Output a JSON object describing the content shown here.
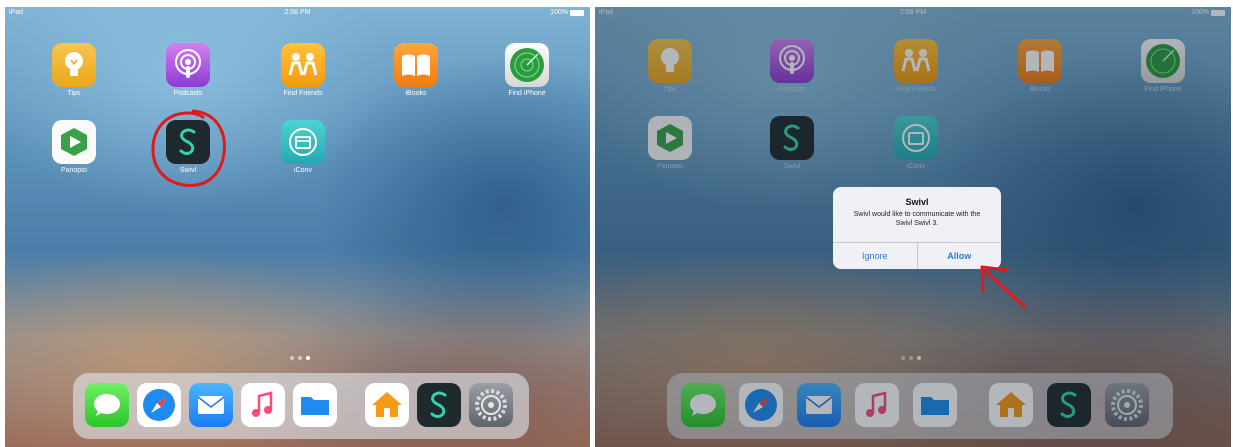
{
  "left": {
    "status": {
      "carrier": "iPad",
      "time": "2:56 PM",
      "battery": "100%"
    },
    "apps": [
      {
        "label": "Tips"
      },
      {
        "label": "Podcasts"
      },
      {
        "label": "Find Friends"
      },
      {
        "label": "iBooks"
      },
      {
        "label": "Find iPhone"
      },
      {
        "label": "Panopto"
      },
      {
        "label": "Swivl"
      },
      {
        "label": "iConv"
      }
    ]
  },
  "right": {
    "status": {
      "carrier": "iPad",
      "time": "2:58 PM",
      "battery": "100%"
    },
    "apps": [
      {
        "label": "Tips"
      },
      {
        "label": "Podcasts"
      },
      {
        "label": "Find Friends"
      },
      {
        "label": "iBooks"
      },
      {
        "label": "Find iPhone"
      },
      {
        "label": "Panopto"
      },
      {
        "label": "Swivl"
      },
      {
        "label": "iConv"
      }
    ],
    "alert": {
      "title": "Swivl",
      "message": "Swivl would like to communicate with the Swivl Swivl 3.",
      "ignore_label": "Ignore",
      "allow_label": "Allow"
    }
  },
  "dock_apps": [
    "Messages",
    "Safari",
    "Mail",
    "Music",
    "Files",
    "Home",
    "Swivl",
    "Settings"
  ],
  "colors": {
    "annotation_red": "#e01a1a",
    "alert_button_blue": "#2a7bdc"
  }
}
